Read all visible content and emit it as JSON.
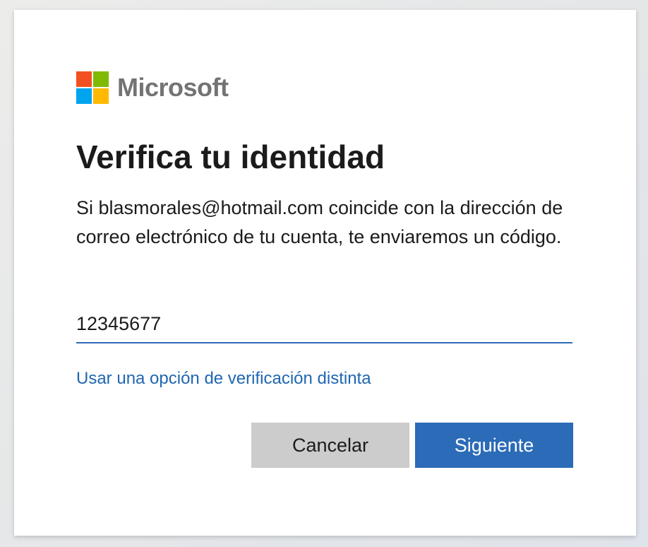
{
  "brand": {
    "name": "Microsoft",
    "logo_colors": [
      "#f25022",
      "#7fba00",
      "#00a4ef",
      "#ffb900"
    ]
  },
  "title": "Verifica tu identidad",
  "description": "Si blasmorales@hotmail.com coincide con la dirección de correo electrónico de tu cuenta, te enviaremos un código.",
  "code_input": {
    "value": "12345677"
  },
  "alt_link": "Usar una opción de verificación distinta",
  "buttons": {
    "cancel_label": "Cancelar",
    "next_label": "Siguiente"
  },
  "colors": {
    "accent": "#2b6bb7",
    "link": "#2067b0"
  }
}
